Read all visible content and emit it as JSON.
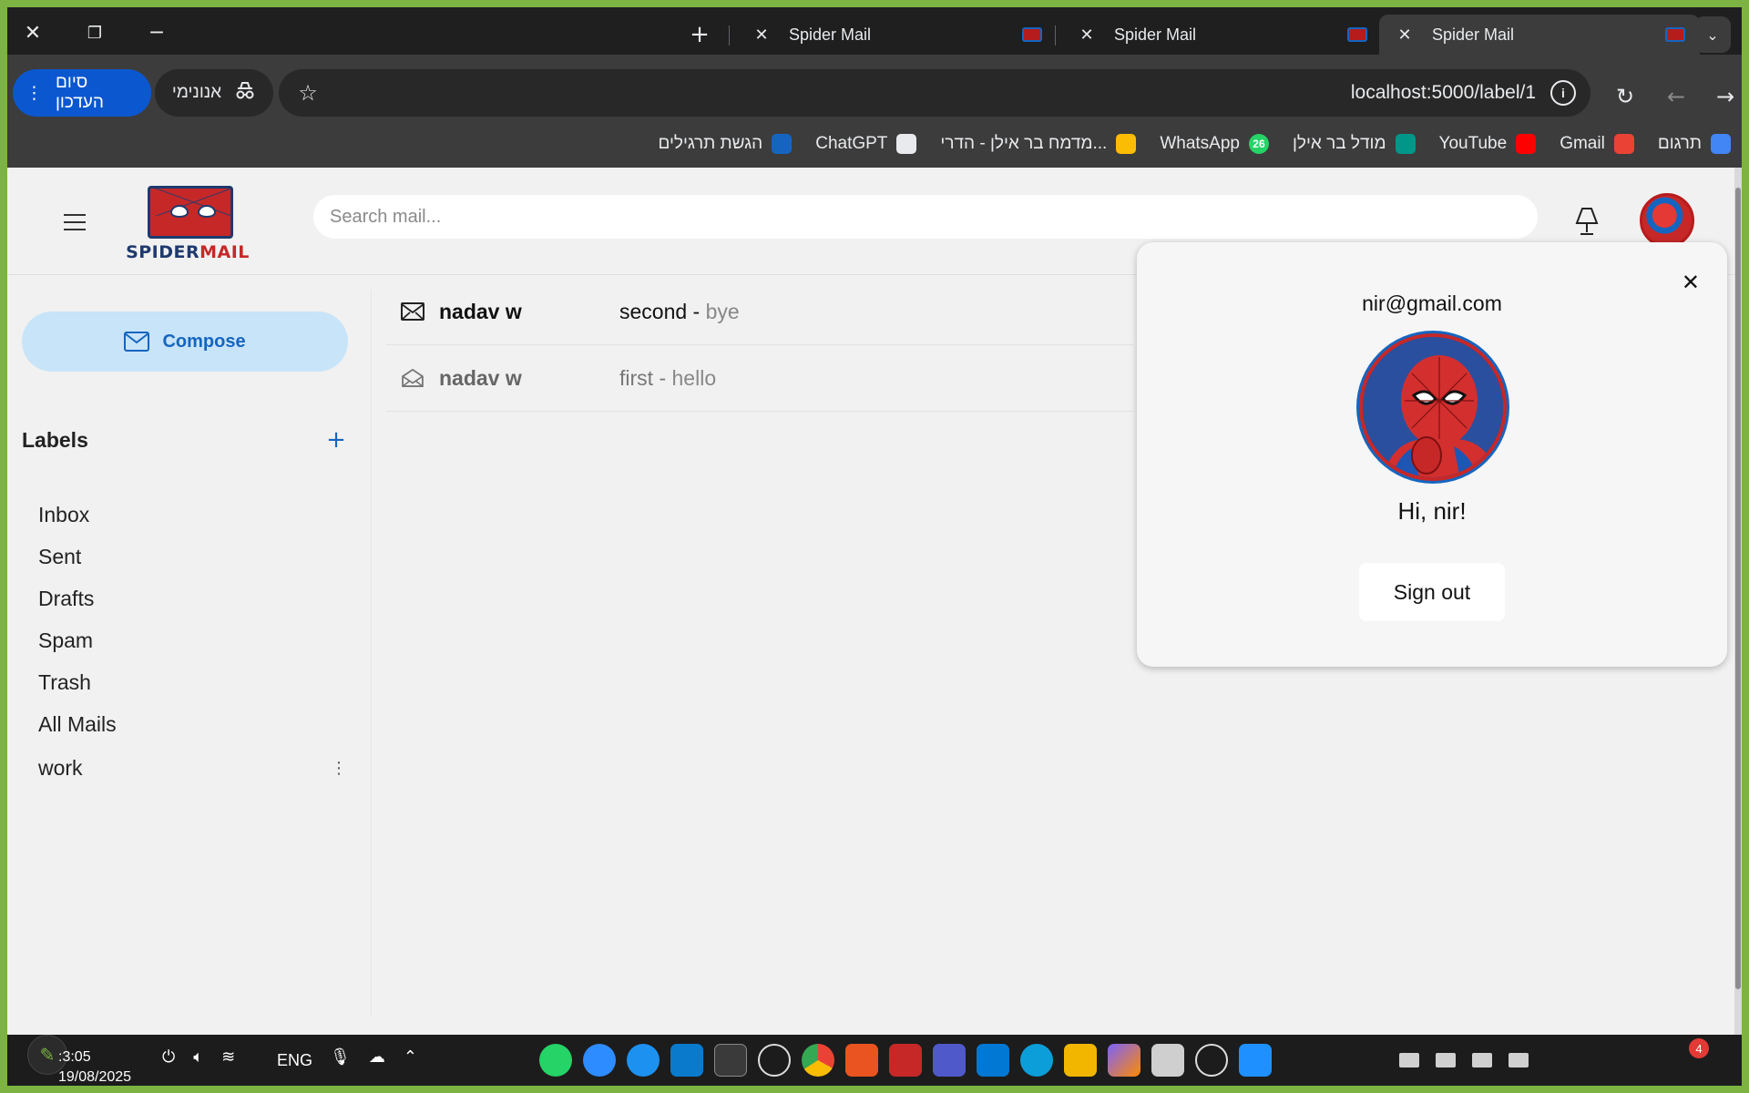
{
  "browser": {
    "tabs": [
      {
        "title": "Spider Mail",
        "active": false
      },
      {
        "title": "Spider Mail",
        "active": false
      },
      {
        "title": "Spider Mail",
        "active": true
      }
    ],
    "end_session_label": "סיום העדכון",
    "incognito_label": "אנונימי",
    "url": "localhost:5000/label/1",
    "bookmarks": [
      {
        "label": "תרגום",
        "icon": "google-translate-icon",
        "color": "#4285f4"
      },
      {
        "label": "Gmail",
        "icon": "gmail-icon",
        "color": "#ea4335"
      },
      {
        "label": "YouTube",
        "icon": "youtube-icon",
        "color": "#ff0000"
      },
      {
        "label": "מודל בר אילן",
        "icon": "moodle-icon",
        "color": "#009688"
      },
      {
        "label": "WhatsApp",
        "icon": "whatsapp-icon",
        "color": "#25d366",
        "badge": "26"
      },
      {
        "label": "מדמח בר אילן - הדרי...",
        "icon": "google-drive-icon",
        "color": "#fbbc04"
      },
      {
        "label": "ChatGPT",
        "icon": "chatgpt-icon",
        "color": "#e8eaed"
      },
      {
        "label": "הגשת תרגילים",
        "icon": "upload-arrow-icon",
        "color": "#1565c0"
      }
    ]
  },
  "app": {
    "logo": {
      "part1": "SPIDER",
      "part2": "MAIL"
    },
    "search_placeholder": "Search mail...",
    "compose_label": "Compose",
    "labels_title": "Labels",
    "add_label": "+",
    "labels": [
      "Inbox",
      "Sent",
      "Drafts",
      "Spam",
      "Trash",
      "All Mails",
      "work"
    ],
    "mails": [
      {
        "sender": "nadav w",
        "subject": "second",
        "separator": " - ",
        "snippet": "bye",
        "read": false
      },
      {
        "sender": "nadav w",
        "subject": "first",
        "separator": " - ",
        "snippet": "hello",
        "read": true
      }
    ],
    "account_popup": {
      "email": "nir@gmail.com",
      "greeting": "Hi, nir!",
      "signout_label": "Sign out"
    }
  },
  "taskbar": {
    "time": ":3:05",
    "date": "19/08/2025",
    "lang": "ENG",
    "notification_count": "4"
  },
  "colors": {
    "accent": "#1565c0",
    "compose_bg": "#c8e4f8",
    "brand_red": "#c62828",
    "brand_navy": "#1e3a6e"
  }
}
